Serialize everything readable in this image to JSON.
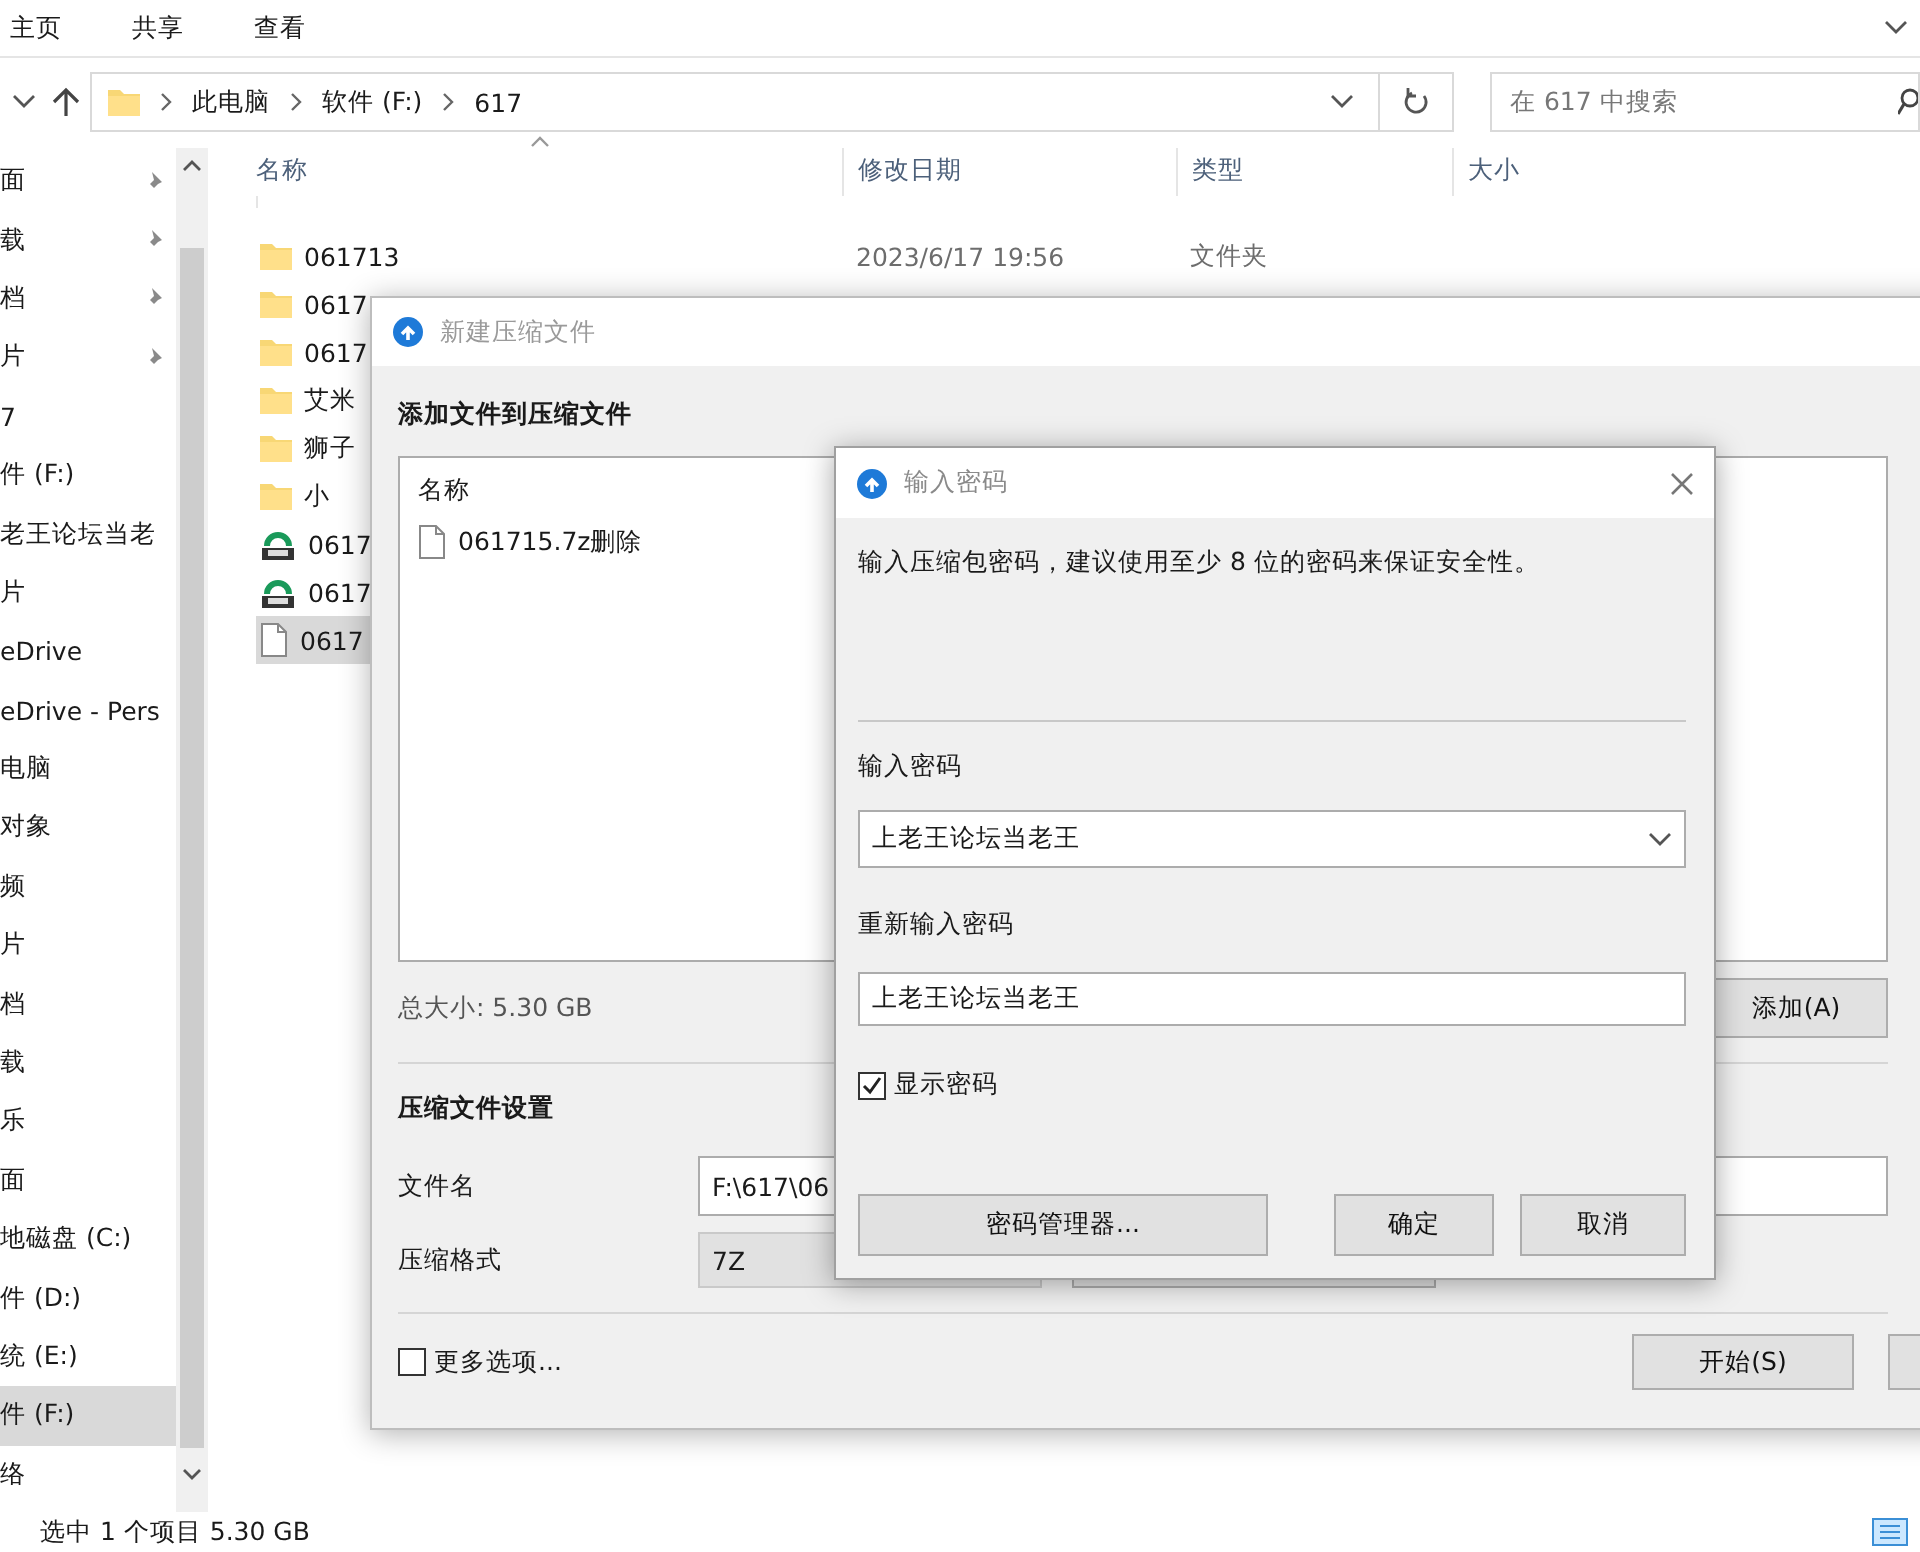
{
  "explorer": {
    "ribbon_tabs": [
      {
        "label": "主页"
      },
      {
        "label": "共享"
      },
      {
        "label": "查看"
      }
    ],
    "breadcrumbs": [
      "此电脑",
      "软件 (F:)",
      "617"
    ],
    "search": {
      "placeholder": "在 617 中搜索"
    },
    "nav_items": [
      {
        "label": "面",
        "pinned": true,
        "selected": false
      },
      {
        "label": "载",
        "pinned": true,
        "selected": false
      },
      {
        "label": "档",
        "pinned": true,
        "selected": false
      },
      {
        "label": "片",
        "pinned": true,
        "selected": false
      },
      {
        "label": "7",
        "pinned": false,
        "selected": false
      },
      {
        "label": "件 (F:)",
        "pinned": false,
        "selected": false
      },
      {
        "label": "老王论坛当老",
        "pinned": false,
        "selected": false
      },
      {
        "label": "片",
        "pinned": false,
        "selected": false
      },
      {
        "label": "eDrive",
        "pinned": false,
        "selected": false
      },
      {
        "label": "eDrive - Pers",
        "pinned": false,
        "selected": false
      },
      {
        "label": "电脑",
        "pinned": false,
        "selected": false
      },
      {
        "label": "对象",
        "pinned": false,
        "selected": false
      },
      {
        "label": "频",
        "pinned": false,
        "selected": false
      },
      {
        "label": "片",
        "pinned": false,
        "selected": false
      },
      {
        "label": "档",
        "pinned": false,
        "selected": false
      },
      {
        "label": "载",
        "pinned": false,
        "selected": false
      },
      {
        "label": "乐",
        "pinned": false,
        "selected": false
      },
      {
        "label": "面",
        "pinned": false,
        "selected": false
      },
      {
        "label": "地磁盘 (C:)",
        "pinned": false,
        "selected": false
      },
      {
        "label": "件 (D:)",
        "pinned": false,
        "selected": false
      },
      {
        "label": "统 (E:)",
        "pinned": false,
        "selected": false
      },
      {
        "label": "件 (F:)",
        "pinned": false,
        "selected": true
      },
      {
        "label": "络",
        "pinned": false,
        "selected": false
      }
    ],
    "columns": [
      "名称",
      "修改日期",
      "类型",
      "大小"
    ],
    "files": [
      {
        "name": "061713",
        "kind": "folder",
        "modified": "2023/6/17 19:56",
        "type": "文件夹",
        "selected": false
      },
      {
        "name": "0617",
        "kind": "folder",
        "selected": false
      },
      {
        "name": "0617",
        "kind": "folder",
        "selected": false
      },
      {
        "name": "艾米",
        "kind": "folder",
        "selected": false
      },
      {
        "name": "狮子",
        "kind": "folder",
        "selected": false
      },
      {
        "name": "小",
        "kind": "folder",
        "selected": false
      },
      {
        "name": "0617",
        "kind": "archive",
        "selected": false
      },
      {
        "name": "0617",
        "kind": "archive",
        "selected": false
      },
      {
        "name": "0617",
        "kind": "file",
        "selected": true
      }
    ],
    "status": "选中 1 个项目  5.30 GB"
  },
  "archive_dialog": {
    "title": "新建压缩文件",
    "heading": "添加文件到压缩文件",
    "list_header": "名称",
    "files": [
      {
        "name": "061715.7z删除"
      }
    ],
    "total_size": "总大小: 5.30 GB",
    "add_button": "添加(A)",
    "settings_heading": "压缩文件设置",
    "filename_label": "文件名",
    "filename_value": "F:\\617\\06",
    "format_label": "压缩格式",
    "format_value": "7Z",
    "more_options": {
      "label": "更多选项...",
      "checked": false
    },
    "start_button": "开始(S)"
  },
  "password_dialog": {
    "title": "输入密码",
    "hint": "输入压缩包密码，建议使用至少 8 位的密码来保证安全性。",
    "password_label": "输入密码",
    "password_value": "上老王论坛当老王",
    "confirm_label": "重新输入密码",
    "confirm_value": "上老王论坛当老王",
    "show_password": {
      "label": "显示密码",
      "checked": true
    },
    "buttons": [
      "密码管理器...",
      "确定",
      "取消"
    ]
  }
}
